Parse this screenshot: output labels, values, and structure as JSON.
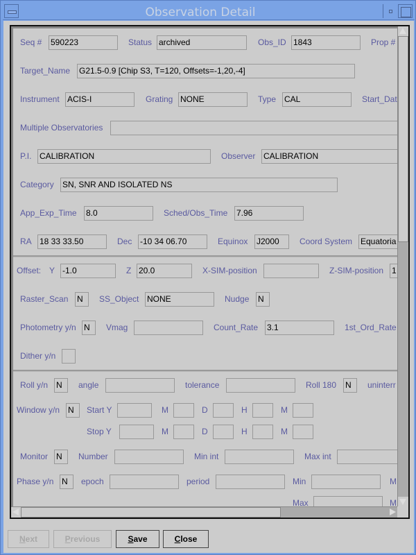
{
  "window": {
    "title": "Observation Detail"
  },
  "general": {
    "seq_label": "Seq #",
    "seq_value": "590223",
    "status_label": "Status",
    "status_value": "archived",
    "obsid_label": "Obs_ID",
    "obsid_value": "1843",
    "prop_label": "Prop #",
    "target_label": "Target_Name",
    "target_value": "G21.5-0.9 [Chip S3, T=120, Offsets=-1,20,-4]",
    "instrument_label": "Instrument",
    "instrument_value": "ACIS-I",
    "grating_label": "Grating",
    "grating_value": "NONE",
    "type_label": "Type",
    "type_value": "CAL",
    "start_date_label": "Start_Dat",
    "multiobs_label": "Multiple Observatories",
    "multiobs_value": "",
    "pi_label": "P.I.",
    "pi_value": "CALIBRATION",
    "observer_label": "Observer",
    "observer_value": "CALIBRATION",
    "category_label": "Category",
    "category_value": "SN, SNR AND ISOLATED NS",
    "app_exp_label": "App_Exp_Time",
    "app_exp_value": "8.0",
    "sched_label": "Sched/Obs_Time",
    "sched_value": "7.96",
    "ra_label": "RA",
    "ra_value": "18 33 33.50",
    "dec_label": "Dec",
    "dec_value": "-10 34 06.70",
    "equinox_label": "Equinox",
    "equinox_value": "J2000",
    "coord_label": "Coord System",
    "coord_value": "Equatoria"
  },
  "offsets": {
    "offset_label": "Offset:",
    "y_label": "Y",
    "y_value": "-1.0",
    "z_label": "Z",
    "z_value": "20.0",
    "xsim_label": "X-SIM-position",
    "xsim_value": "",
    "zsim_label": "Z-SIM-position",
    "zsim_value": "1",
    "raster_label": "Raster_Scan",
    "raster_value": "N",
    "ssobj_label": "SS_Object",
    "ssobj_value": "NONE",
    "nudge_label": "Nudge",
    "nudge_value": "N",
    "photometry_label": "Photometry y/n",
    "photometry_value": "N",
    "vmag_label": "Vmag",
    "vmag_value": "",
    "count_rate_label": "Count_Rate",
    "count_rate_value": "3.1",
    "first_ord_label": "1st_Ord_Rate",
    "dither_label": "Dither y/n",
    "dither_value": ""
  },
  "constraints": {
    "roll_label": "Roll y/n",
    "roll_value": "N",
    "angle_label": "angle",
    "angle_value": "",
    "tolerance_label": "tolerance",
    "tolerance_value": "",
    "roll180_label": "Roll 180",
    "roll180_value": "N",
    "uninterr_label": "uninterr",
    "window_label": "Window y/n",
    "window_value": "N",
    "start_label": "Start Y",
    "stop_label": "Stop  Y",
    "m_label": "M",
    "d_label": "D",
    "h_label": "H",
    "min_label": "M",
    "monitor_label": "Monitor",
    "monitor_value": "N",
    "number_label": "Number",
    "min_int_label": "Min int",
    "max_int_label": "Max int",
    "phase_label": "Phase y/n",
    "phase_value": "N",
    "epoch_label": "epoch",
    "period_label": "period",
    "phase_min_label": "Min",
    "phase_max_label": "Max",
    "phase_m_label": "M"
  },
  "buttons": {
    "next": {
      "accel": "N",
      "rest": "ext"
    },
    "previous": {
      "accel": "P",
      "rest": "revious"
    },
    "save": {
      "accel": "S",
      "rest": "ave"
    },
    "close": {
      "accel": "C",
      "rest": "lose"
    }
  }
}
